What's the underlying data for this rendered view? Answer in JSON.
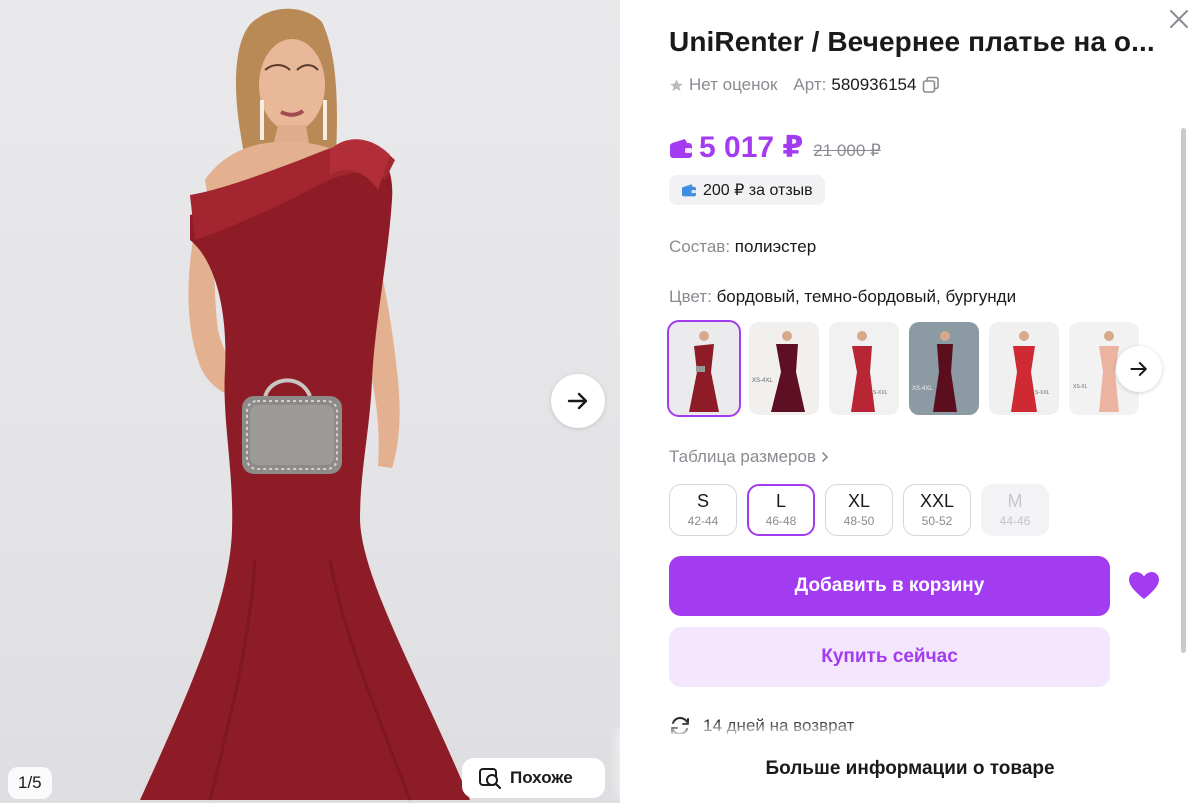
{
  "gallery": {
    "counter": "1/5",
    "similar_label": "Похоже"
  },
  "product": {
    "title": "UniRenter / Вечернее платье на о...",
    "rating_text": "Нет оценок",
    "article_label": "Арт:",
    "article_value": "580936154",
    "price": "5 017 ₽",
    "old_price": "21 000 ₽",
    "review_bonus": "200 ₽ за отзыв",
    "composition_label": "Состав:",
    "composition_value": "полиэстер",
    "color_label": "Цвет:",
    "color_value": "бордовый, темно-бордовый, бургунди",
    "swatch_labels": [
      "",
      "XS-4XL",
      "",
      "XS-4XL",
      "S-XXL",
      "XS-XL"
    ],
    "size_table_label": "Таблица размеров",
    "sizes": [
      {
        "name": "S",
        "range": "42-44"
      },
      {
        "name": "L",
        "range": "46-48"
      },
      {
        "name": "XL",
        "range": "48-50"
      },
      {
        "name": "XXL",
        "range": "50-52"
      },
      {
        "name": "M",
        "range": "44-46"
      }
    ],
    "add_to_cart": "Добавить в корзину",
    "buy_now": "Купить сейчас",
    "return_text": "14 дней на возврат",
    "more_info": "Больше информации о товаре"
  },
  "colors": {
    "accent": "#a33bf0",
    "accent_light": "#f3e6fd",
    "dress": "#8e1c26",
    "muted_text": "#8b8b92"
  }
}
